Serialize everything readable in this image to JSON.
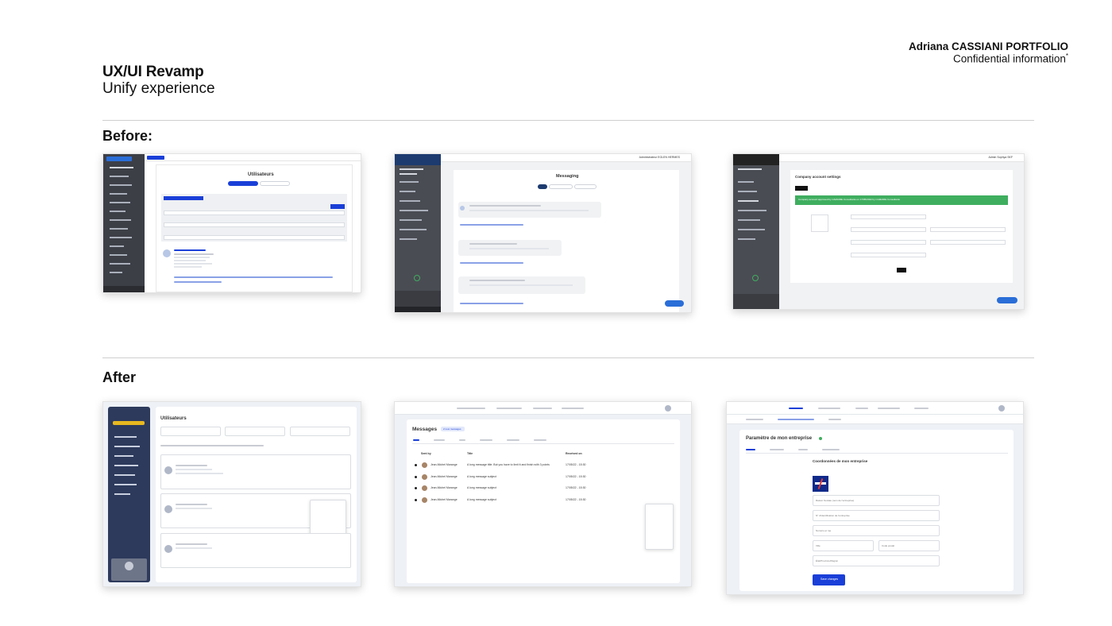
{
  "header": {
    "title": "UX/UI Revamp",
    "subtitle": "Unify experience",
    "author": "Adriana CASSIANI PORTFOLIO",
    "confidential": "Confidential information",
    "asterisk": "*"
  },
  "sections": {
    "before": "Before:",
    "after": "After"
  },
  "before_screens": {
    "users_title": "Utilisateurs",
    "messaging_title": "Messaging",
    "company_title": "Company account settings",
    "company_banner": "Company account approved by CAMAIRE Consultants on 17/05/2022 by CAMAIRE Consultants",
    "messaging_admin": "Administrateur EGLEN HERMES",
    "company_admin": "Admin Sophya SKF"
  },
  "after_screens": {
    "users_title": "Utilisateurs",
    "messages_title": "Messages",
    "messages_badge": "2 new messages",
    "messages_columns": [
      "Sent by",
      "Title",
      "Received on"
    ],
    "messages_rows": [
      {
        "sender": "Jean-Michel Marange",
        "title": "A long message title. But you have to limit it and finish with 3 points",
        "date": "17/05/22 - 15:30"
      },
      {
        "sender": "Jean-Michel Marange",
        "title": "A long message subject",
        "date": "17/05/22 - 15:30"
      },
      {
        "sender": "Jean-Michel Marange",
        "title": "A long message subject",
        "date": "17/05/22 - 15:30"
      },
      {
        "sender": "Jean-Michel Marange",
        "title": "A long message subject",
        "date": "17/05/22 - 15:30"
      }
    ],
    "company_title": "Paramètre de mon entreprise",
    "company_section": "Coordonnées de mon entreprise",
    "company_save": "Save changes",
    "company_fields": [
      "Raison Sociale (nom de l'entreprise)",
      "N° d'identification de l'entreprise",
      "Numéro et rue",
      "Ville",
      "Code postal",
      "État/Province/Région"
    ]
  },
  "colors": {
    "accent_blue": "#1a3fd8",
    "dark_sidebar": "#3d3f47",
    "navy_sidebar": "#2d3a5c",
    "green_banner": "#3fae5f"
  }
}
